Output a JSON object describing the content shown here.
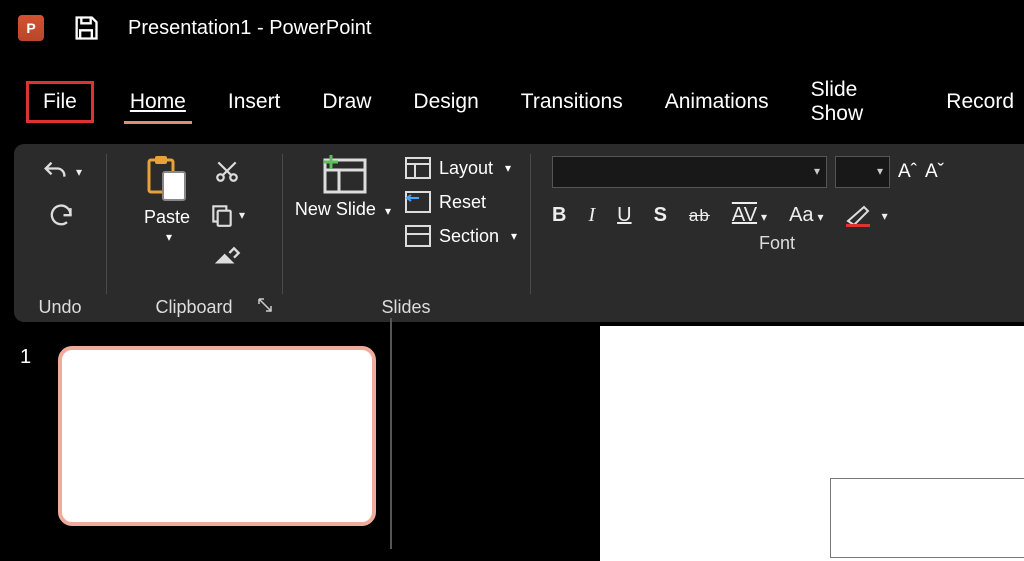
{
  "title": "Presentation1  -  PowerPoint",
  "app_icon_letter": "P",
  "tabs": {
    "file": "File",
    "home": "Home",
    "insert": "Insert",
    "draw": "Draw",
    "design": "Design",
    "transitions": "Transitions",
    "animations": "Animations",
    "slide_show": "Slide Show",
    "record": "Record"
  },
  "ribbon": {
    "undo": {
      "label": "Undo"
    },
    "clipboard": {
      "paste": "Paste",
      "label": "Clipboard"
    },
    "slides": {
      "new_slide": "New Slide",
      "layout": "Layout",
      "reset": "Reset",
      "section": "Section",
      "label": "Slides"
    },
    "font": {
      "label": "Font",
      "bold": "B",
      "italic": "I",
      "underline": "U",
      "shadow": "S",
      "strike": "ab",
      "spacing": "AV",
      "case": "Aa",
      "grow": "Aˆ",
      "shrink": "Aˇ"
    }
  },
  "thumbnail": {
    "number": "1"
  }
}
